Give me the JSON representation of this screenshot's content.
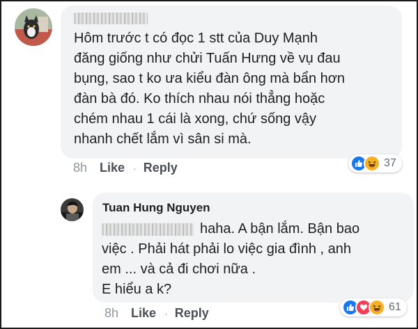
{
  "comments": [
    {
      "text": "Hôm trước t có đọc 1 stt của Duy Mạnh\nđăng giống như chửi Tuấn Hưng về vụ đau\nbụng, sao t ko ưa kiểu đàn ông mà bẩn hơn\nđàn bà đó. Ko thích nhau nói thẳng hoặc\nchém nhau 1 cái là xong, chứ sống vậy\nnhanh chết lắm vì sân si mà.",
      "time": "8h",
      "like_label": "Like",
      "reply_label": "Reply",
      "reaction_icons": [
        "like-icon",
        "haha-icon"
      ],
      "reaction_count": "37"
    }
  ],
  "reply": {
    "author": "Tuan Hung Nguyen",
    "lines": [
      "haha. A bận lắm. Bận bao",
      "việc . Phải hát phải lo việc gia đình , anh",
      "em ... và cả đi chơi nữa .",
      "E hiểu a k?"
    ],
    "time": "8h",
    "like_label": "Like",
    "reply_label": "Reply",
    "reaction_icons": [
      "like-icon",
      "love-icon",
      "haha-icon"
    ],
    "reaction_count": "61"
  },
  "colors": {
    "like": "#1877f2",
    "love": "#f33e58",
    "haha": "#f7b125",
    "bubble": "#f2f3f5"
  }
}
